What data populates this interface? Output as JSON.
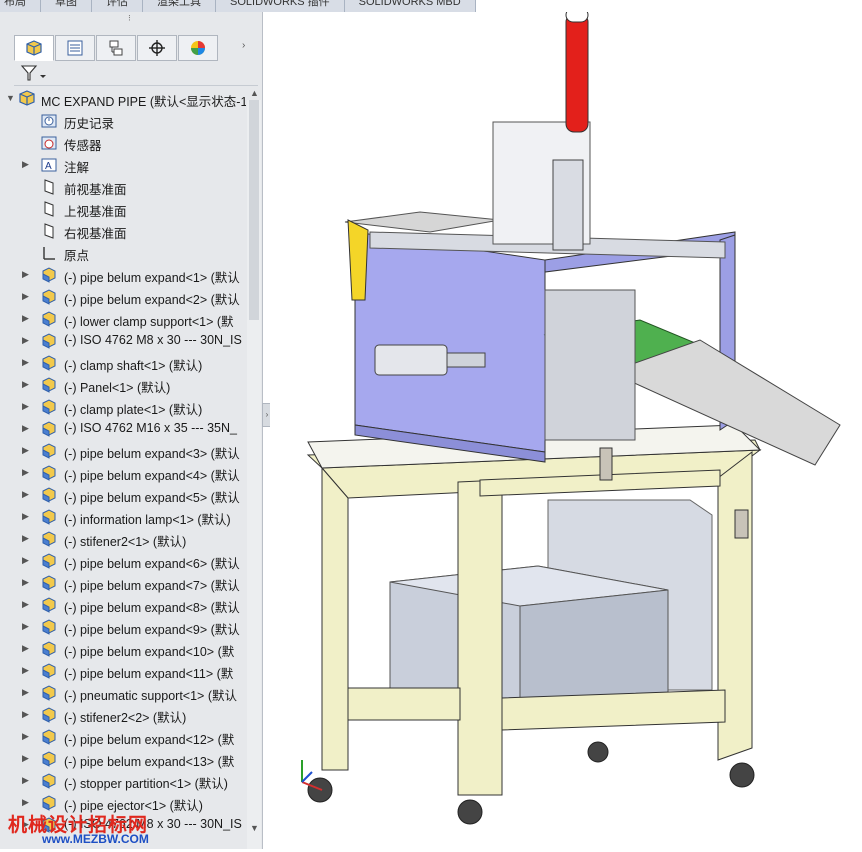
{
  "top_tabs": [
    "布局",
    "草图",
    "评估",
    "渲染工具",
    "SOLIDWORKS 插件",
    "SOLIDWORKS MBD"
  ],
  "panel": {
    "root_label": "MC EXPAND PIPE (默认<显示状态-1",
    "items": [
      {
        "label": "历史记录",
        "icon": "history-icon",
        "type": "sub",
        "arrow": false
      },
      {
        "label": "传感器",
        "icon": "sensor-icon",
        "type": "sub",
        "arrow": false
      },
      {
        "label": "注解",
        "icon": "annotation-icon",
        "type": "sub",
        "arrow": true
      },
      {
        "label": "前视基准面",
        "icon": "plane-icon",
        "type": "sub",
        "arrow": false
      },
      {
        "label": "上视基准面",
        "icon": "plane-icon",
        "type": "sub",
        "arrow": false
      },
      {
        "label": "右视基准面",
        "icon": "plane-icon",
        "type": "sub",
        "arrow": false
      },
      {
        "label": "原点",
        "icon": "origin-icon",
        "type": "sub",
        "arrow": false
      },
      {
        "label": "(-) pipe belum expand<1> (默认",
        "icon": "part-icon",
        "type": "comp",
        "arrow": true
      },
      {
        "label": "(-) pipe belum expand<2> (默认",
        "icon": "part-icon",
        "type": "comp",
        "arrow": true
      },
      {
        "label": "(-) lower clamp support<1> (默",
        "icon": "part-icon",
        "type": "comp",
        "arrow": true
      },
      {
        "label": "(-) ISO 4762 M8 x 30 --- 30N_IS",
        "icon": "part-icon",
        "type": "comp",
        "arrow": true
      },
      {
        "label": "(-) clamp shaft<1> (默认)",
        "icon": "part-icon",
        "type": "comp",
        "arrow": true
      },
      {
        "label": "(-) Panel<1> (默认)",
        "icon": "part-icon",
        "type": "comp",
        "arrow": true
      },
      {
        "label": "(-) clamp plate<1> (默认)",
        "icon": "part-icon",
        "type": "comp",
        "arrow": true
      },
      {
        "label": "(-) ISO 4762 M16 x 35 --- 35N_",
        "icon": "part-icon",
        "type": "comp",
        "arrow": true
      },
      {
        "label": "(-) pipe belum expand<3> (默认",
        "icon": "part-icon",
        "type": "comp",
        "arrow": true
      },
      {
        "label": "(-) pipe belum expand<4> (默认",
        "icon": "part-icon",
        "type": "comp",
        "arrow": true
      },
      {
        "label": "(-) pipe belum expand<5> (默认",
        "icon": "part-icon",
        "type": "comp",
        "arrow": true
      },
      {
        "label": "(-) information lamp<1> (默认)",
        "icon": "part-icon",
        "type": "comp",
        "arrow": true
      },
      {
        "label": "(-) stifener2<1> (默认)",
        "icon": "part-icon",
        "type": "comp",
        "arrow": true
      },
      {
        "label": "(-) pipe belum expand<6> (默认",
        "icon": "part-icon",
        "type": "comp",
        "arrow": true
      },
      {
        "label": "(-) pipe belum expand<7> (默认",
        "icon": "part-icon",
        "type": "comp",
        "arrow": true
      },
      {
        "label": "(-) pipe belum expand<8> (默认",
        "icon": "part-icon",
        "type": "comp",
        "arrow": true
      },
      {
        "label": "(-) pipe belum expand<9> (默认",
        "icon": "part-icon",
        "type": "comp",
        "arrow": true
      },
      {
        "label": "(-) pipe belum expand<10> (默",
        "icon": "part-icon",
        "type": "comp",
        "arrow": true
      },
      {
        "label": "(-) pipe belum expand<11> (默",
        "icon": "part-icon",
        "type": "comp",
        "arrow": true
      },
      {
        "label": "(-) pneumatic support<1> (默认",
        "icon": "part-icon",
        "type": "comp",
        "arrow": true
      },
      {
        "label": "(-) stifener2<2> (默认)",
        "icon": "part-icon",
        "type": "comp",
        "arrow": true
      },
      {
        "label": "(-) pipe belum expand<12> (默",
        "icon": "part-icon",
        "type": "comp",
        "arrow": true
      },
      {
        "label": "(-) pipe belum expand<13> (默",
        "icon": "part-icon",
        "type": "comp",
        "arrow": true
      },
      {
        "label": "(-) stopper partition<1> (默认)",
        "icon": "part-icon",
        "type": "comp",
        "arrow": true
      },
      {
        "label": "(-) pipe ejector<1> (默认)",
        "icon": "part-icon",
        "type": "comp",
        "arrow": true
      },
      {
        "label": "(-) ISO 4762 M8 x 30 --- 30N_IS",
        "icon": "part-icon",
        "type": "comp",
        "arrow": true
      }
    ]
  },
  "watermark": {
    "text": "机械设计招标网",
    "url": "www.MEZBW.COM"
  },
  "colors": {
    "panel_bg": "#e6e8eb",
    "frame_yellow": "#f1f0c8",
    "panel_purple": "#a6a8ee",
    "chute_green": "#4fb04f",
    "lamp_red": "#e3201b"
  }
}
